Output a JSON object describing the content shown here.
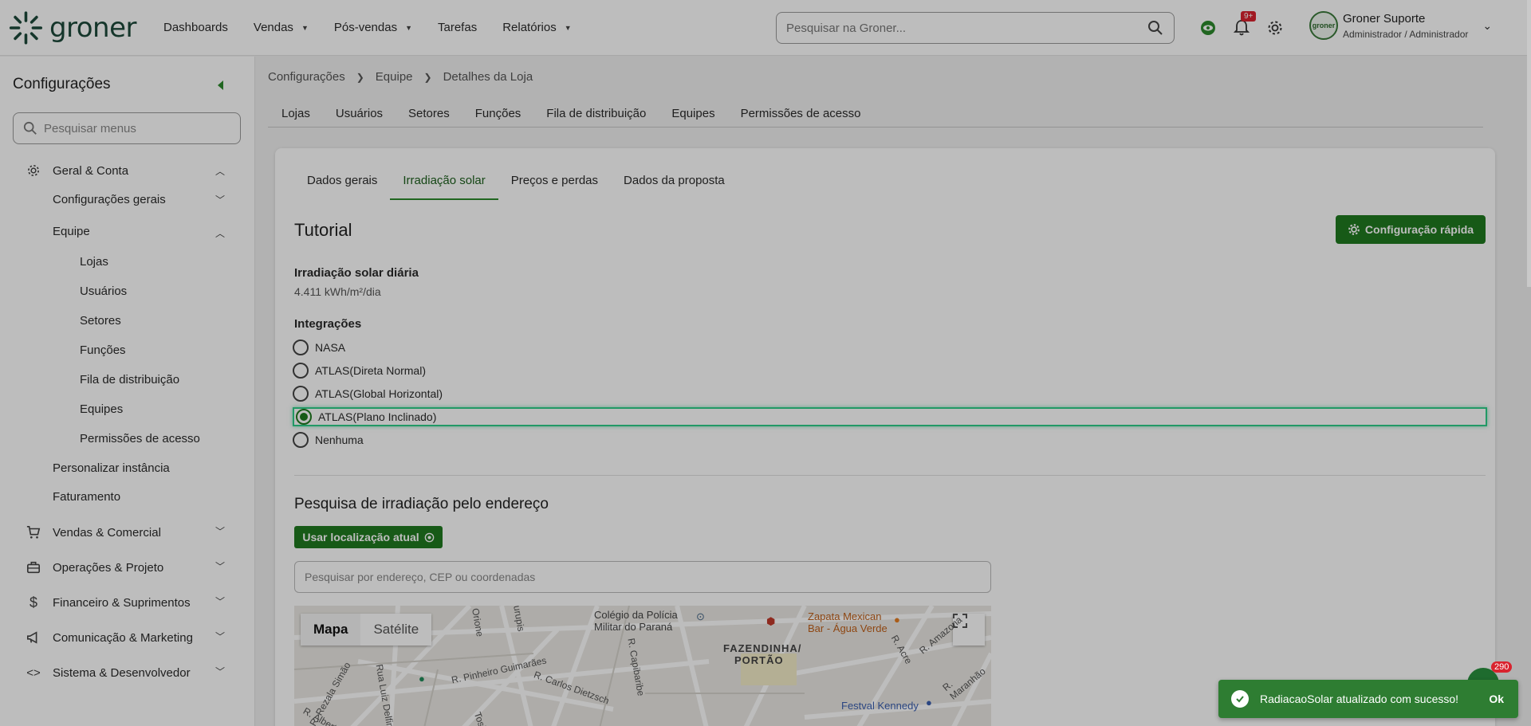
{
  "app": {
    "logo_text": "groner"
  },
  "nav": {
    "items": [
      {
        "label": "Dashboards",
        "dropdown": false
      },
      {
        "label": "Vendas",
        "dropdown": true
      },
      {
        "label": "Pós-vendas",
        "dropdown": true
      },
      {
        "label": "Tarefas",
        "dropdown": false
      },
      {
        "label": "Relatórios",
        "dropdown": true
      }
    ]
  },
  "search": {
    "placeholder": "Pesquisar na Groner..."
  },
  "notifications": {
    "badge": "9+"
  },
  "user": {
    "name": "Groner Suporte",
    "role": "Administrador / Administrador",
    "avatar_text": "groner"
  },
  "sidebar": {
    "title": "Configurações",
    "search_placeholder": "Pesquisar menus",
    "items": [
      {
        "label": "Geral & Conta",
        "icon": "gear-icon"
      },
      {
        "label": "Configurações gerais"
      },
      {
        "label": "Equipe"
      },
      {
        "label": "Lojas"
      },
      {
        "label": "Usuários"
      },
      {
        "label": "Setores"
      },
      {
        "label": "Funções"
      },
      {
        "label": "Fila de distribuição"
      },
      {
        "label": "Equipes"
      },
      {
        "label": "Permissões de acesso"
      },
      {
        "label": "Personalizar instância"
      },
      {
        "label": "Faturamento"
      },
      {
        "label": "Vendas & Comercial",
        "icon": "cart-icon"
      },
      {
        "label": "Operações & Projeto",
        "icon": "briefcase-icon"
      },
      {
        "label": "Financeiro & Suprimentos",
        "icon": "dollar-icon"
      },
      {
        "label": "Comunicação & Marketing",
        "icon": "megaphone-icon"
      },
      {
        "label": "Sistema & Desenvolvedor",
        "icon": "code-icon"
      }
    ]
  },
  "breadcrumb": [
    "Configurações",
    "Equipe",
    "Detalhes da Loja"
  ],
  "top_tabs": [
    "Lojas",
    "Usuários",
    "Setores",
    "Funções",
    "Fila de distribuição",
    "Equipes",
    "Permissões de acesso"
  ],
  "inner_tabs": [
    "Dados gerais",
    "Irradiação solar",
    "Preços e perdas",
    "Dados da proposta"
  ],
  "content": {
    "title": "Tutorial",
    "quick_config_label": "Configuração rápida",
    "daily_irradiation_label": "Irradiação solar diária",
    "daily_irradiation_value": "4.411 kWh/m²/dia",
    "integrations_label": "Integrações",
    "integrations": [
      {
        "label": "NASA",
        "checked": false
      },
      {
        "label": "ATLAS(Direta Normal)",
        "checked": false
      },
      {
        "label": "ATLAS(Global Horizontal)",
        "checked": false
      },
      {
        "label": "ATLAS(Plano Inclinado)",
        "checked": true
      },
      {
        "label": "Nenhuma",
        "checked": false
      }
    ],
    "address_search_title": "Pesquisa de irradiação pelo endereço",
    "use_location_label": "Usar localização atual",
    "address_placeholder": "Pesquisar por endereço, CEP ou coordenadas"
  },
  "map": {
    "toggle": [
      "Mapa",
      "Satélite"
    ],
    "labels": {
      "colegio": "Colégio da Polícia",
      "colegio2": "Militar do Paraná",
      "fazendinha": "FAZENDINHA/",
      "portao": "PORTÃO",
      "zapata": "Zapata Mexican",
      "zapata2": "Bar - Água Verde",
      "festval": "Festval Kennedy",
      "pinheiro": "R. Pinheiro Guimarães",
      "carlos": "R. Carlos Dietzsch",
      "capibaribe": "R. Capibaribe",
      "rezala": "R. Rezala Simão",
      "alberto": "R. Alberto K",
      "luiz": "Rua Luiz Delfino",
      "acre": "R. Acre",
      "amazonas": "R. Amazona",
      "maranhao": "R. Maranhão",
      "tosin": "Tosin",
      "jurupis": "Jurupis",
      "orione": "Orione"
    }
  },
  "toast": {
    "message": "RadiacaoSolar atualizado com sucesso!",
    "ok_label": "Ok",
    "chat_badge": "290"
  },
  "colors": {
    "accent": "#1f7a1f",
    "toast": "#2e7d32",
    "selection_outline": "#2fcf8a"
  }
}
